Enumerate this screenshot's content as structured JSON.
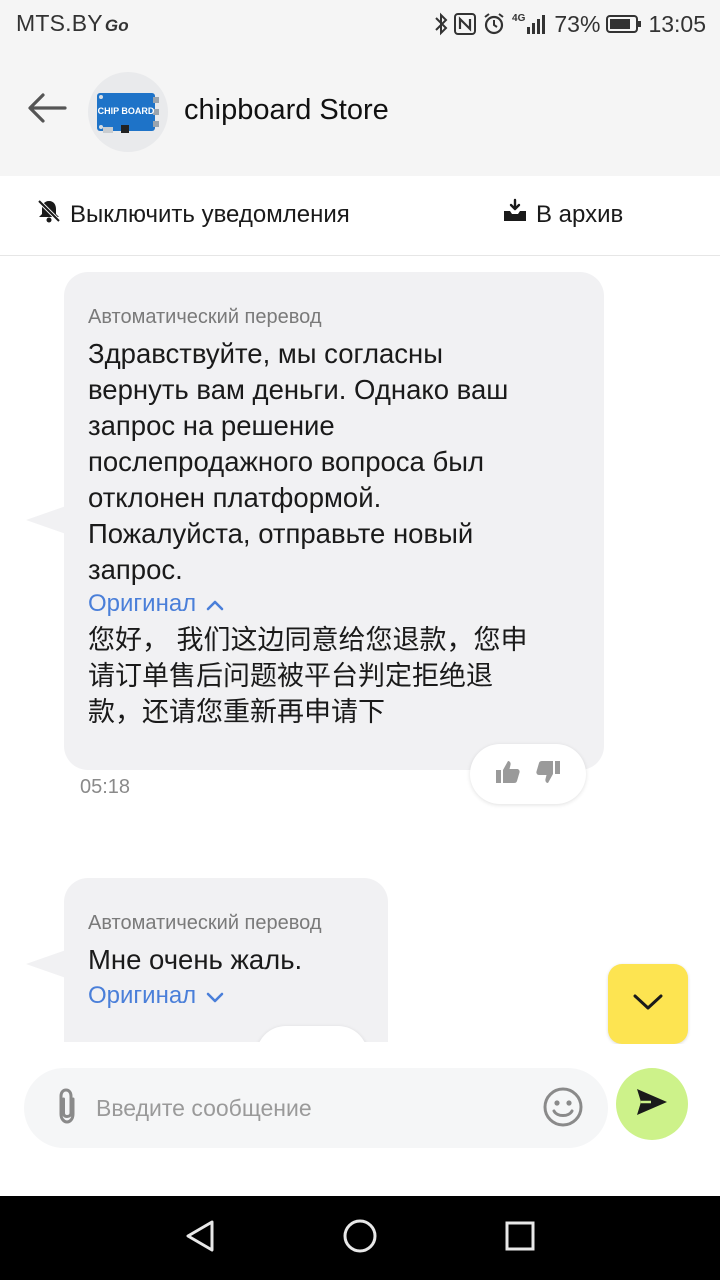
{
  "status_bar": {
    "carrier": "MTS.BY",
    "carrier_badge": "Go",
    "network": "4G",
    "battery": "73%",
    "time": "13:05"
  },
  "header": {
    "title": "chipboard Store",
    "avatar_label": "CHIP BOARD"
  },
  "actions": {
    "mute_label": "Выключить уведомления",
    "archive_label": "В архив"
  },
  "messages": [
    {
      "auto_label": "Автоматический перевод",
      "text_lines": [
        "Здравствуйте, мы согласны",
        "вернуть вам деньги. Однако ваш",
        "запрос на решение",
        "послепродажного вопроса был",
        "отклонен платформой.",
        "Пожалуйста, отправьте новый",
        "запрос."
      ],
      "original_link": "Оригинал",
      "original_expanded": true,
      "original_lines": [
        "您好， 我们这边同意给您退款，您申",
        "请订单售后问题被平台判定拒绝退",
        "款，还请您重新再申请下"
      ],
      "time": "05:18"
    },
    {
      "auto_label": "Автоматический перевод",
      "text_lines": [
        "Мне очень жаль."
      ],
      "original_link": "Оригинал",
      "original_expanded": false
    }
  ],
  "composer": {
    "placeholder": "Введите сообщение"
  },
  "colors": {
    "accent_yellow": "#fde451",
    "send_green": "#cdf28a",
    "link_blue": "#4a7fd9",
    "bubble_gray": "#f1f1f3"
  },
  "icons": {
    "back": "arrow-left-icon",
    "mute": "bell-off-icon",
    "archive": "archive-icon",
    "like": "thumbs-up-icon",
    "dislike": "thumbs-down-icon",
    "scroll": "chevron-down-icon",
    "attach": "paperclip-icon",
    "emoji": "smiley-icon",
    "send": "send-icon"
  }
}
